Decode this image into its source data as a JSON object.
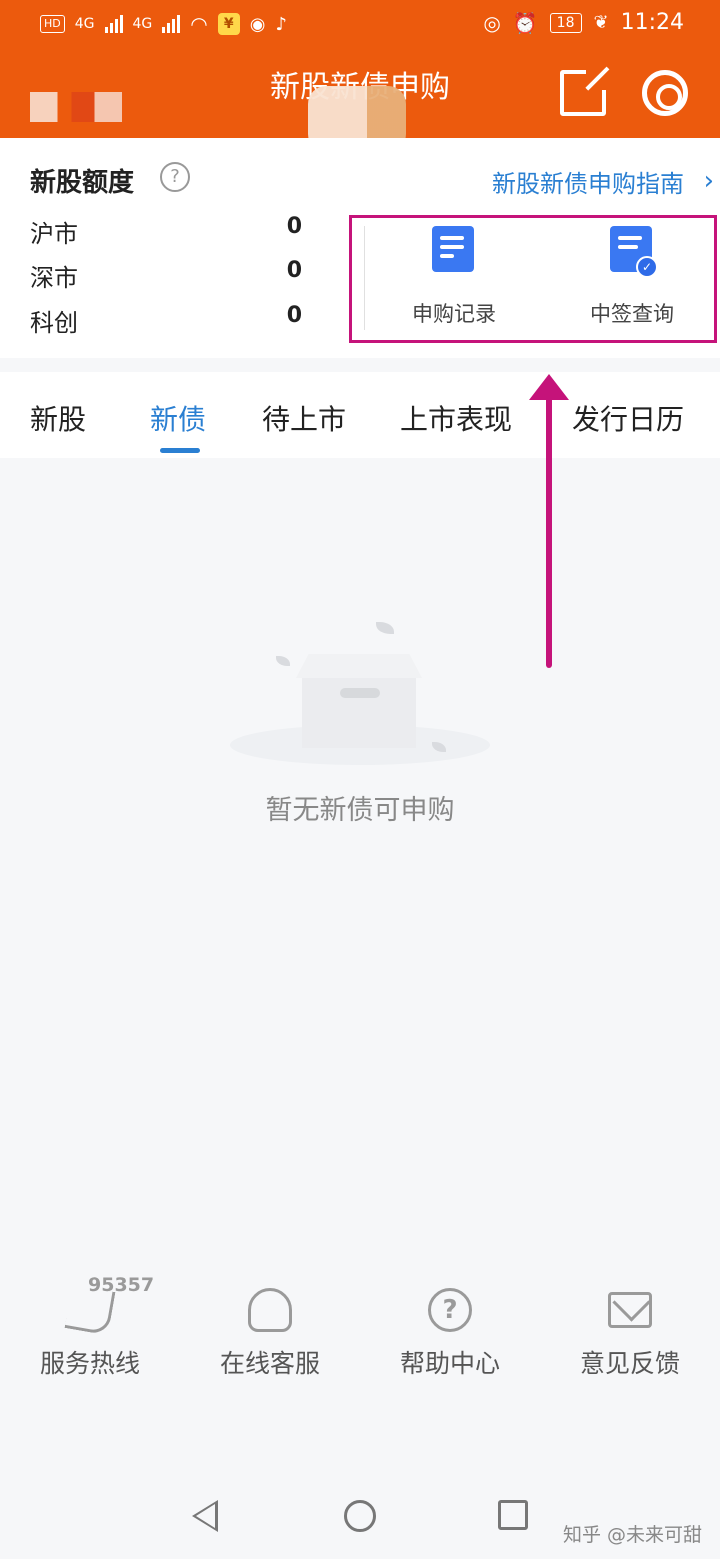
{
  "status_bar": {
    "hd_label": "HD",
    "net1": "4G",
    "net2": "4G",
    "badge": "¥",
    "battery": "18",
    "time": "11:24"
  },
  "header": {
    "title": "新股新债申购"
  },
  "quota": {
    "title": "新股额度",
    "help": "?",
    "guide_link": "新股新债申购指南",
    "markets": [
      {
        "name": "沪市",
        "value": "0"
      },
      {
        "name": "深市",
        "value": "0"
      },
      {
        "name": "科创",
        "value": "0"
      }
    ],
    "actions": [
      {
        "label": "申购记录"
      },
      {
        "label": "中签查询"
      }
    ]
  },
  "tabs": [
    {
      "label": "新股"
    },
    {
      "label": "新债"
    },
    {
      "label": "待上市"
    },
    {
      "label": "上市表现"
    },
    {
      "label": "发行日历"
    }
  ],
  "active_tab": "新债",
  "empty_state": {
    "text": "暂无新债可申购"
  },
  "services": [
    {
      "label": "服务热线",
      "number": "95357"
    },
    {
      "label": "在线客服"
    },
    {
      "label": "帮助中心"
    },
    {
      "label": "意见反馈"
    }
  ],
  "watermark": "知乎 @未来可甜",
  "colors": {
    "header_bg": "#ec5a0d",
    "accent_blue": "#2a7fd2",
    "annotation": "#c5137a"
  }
}
